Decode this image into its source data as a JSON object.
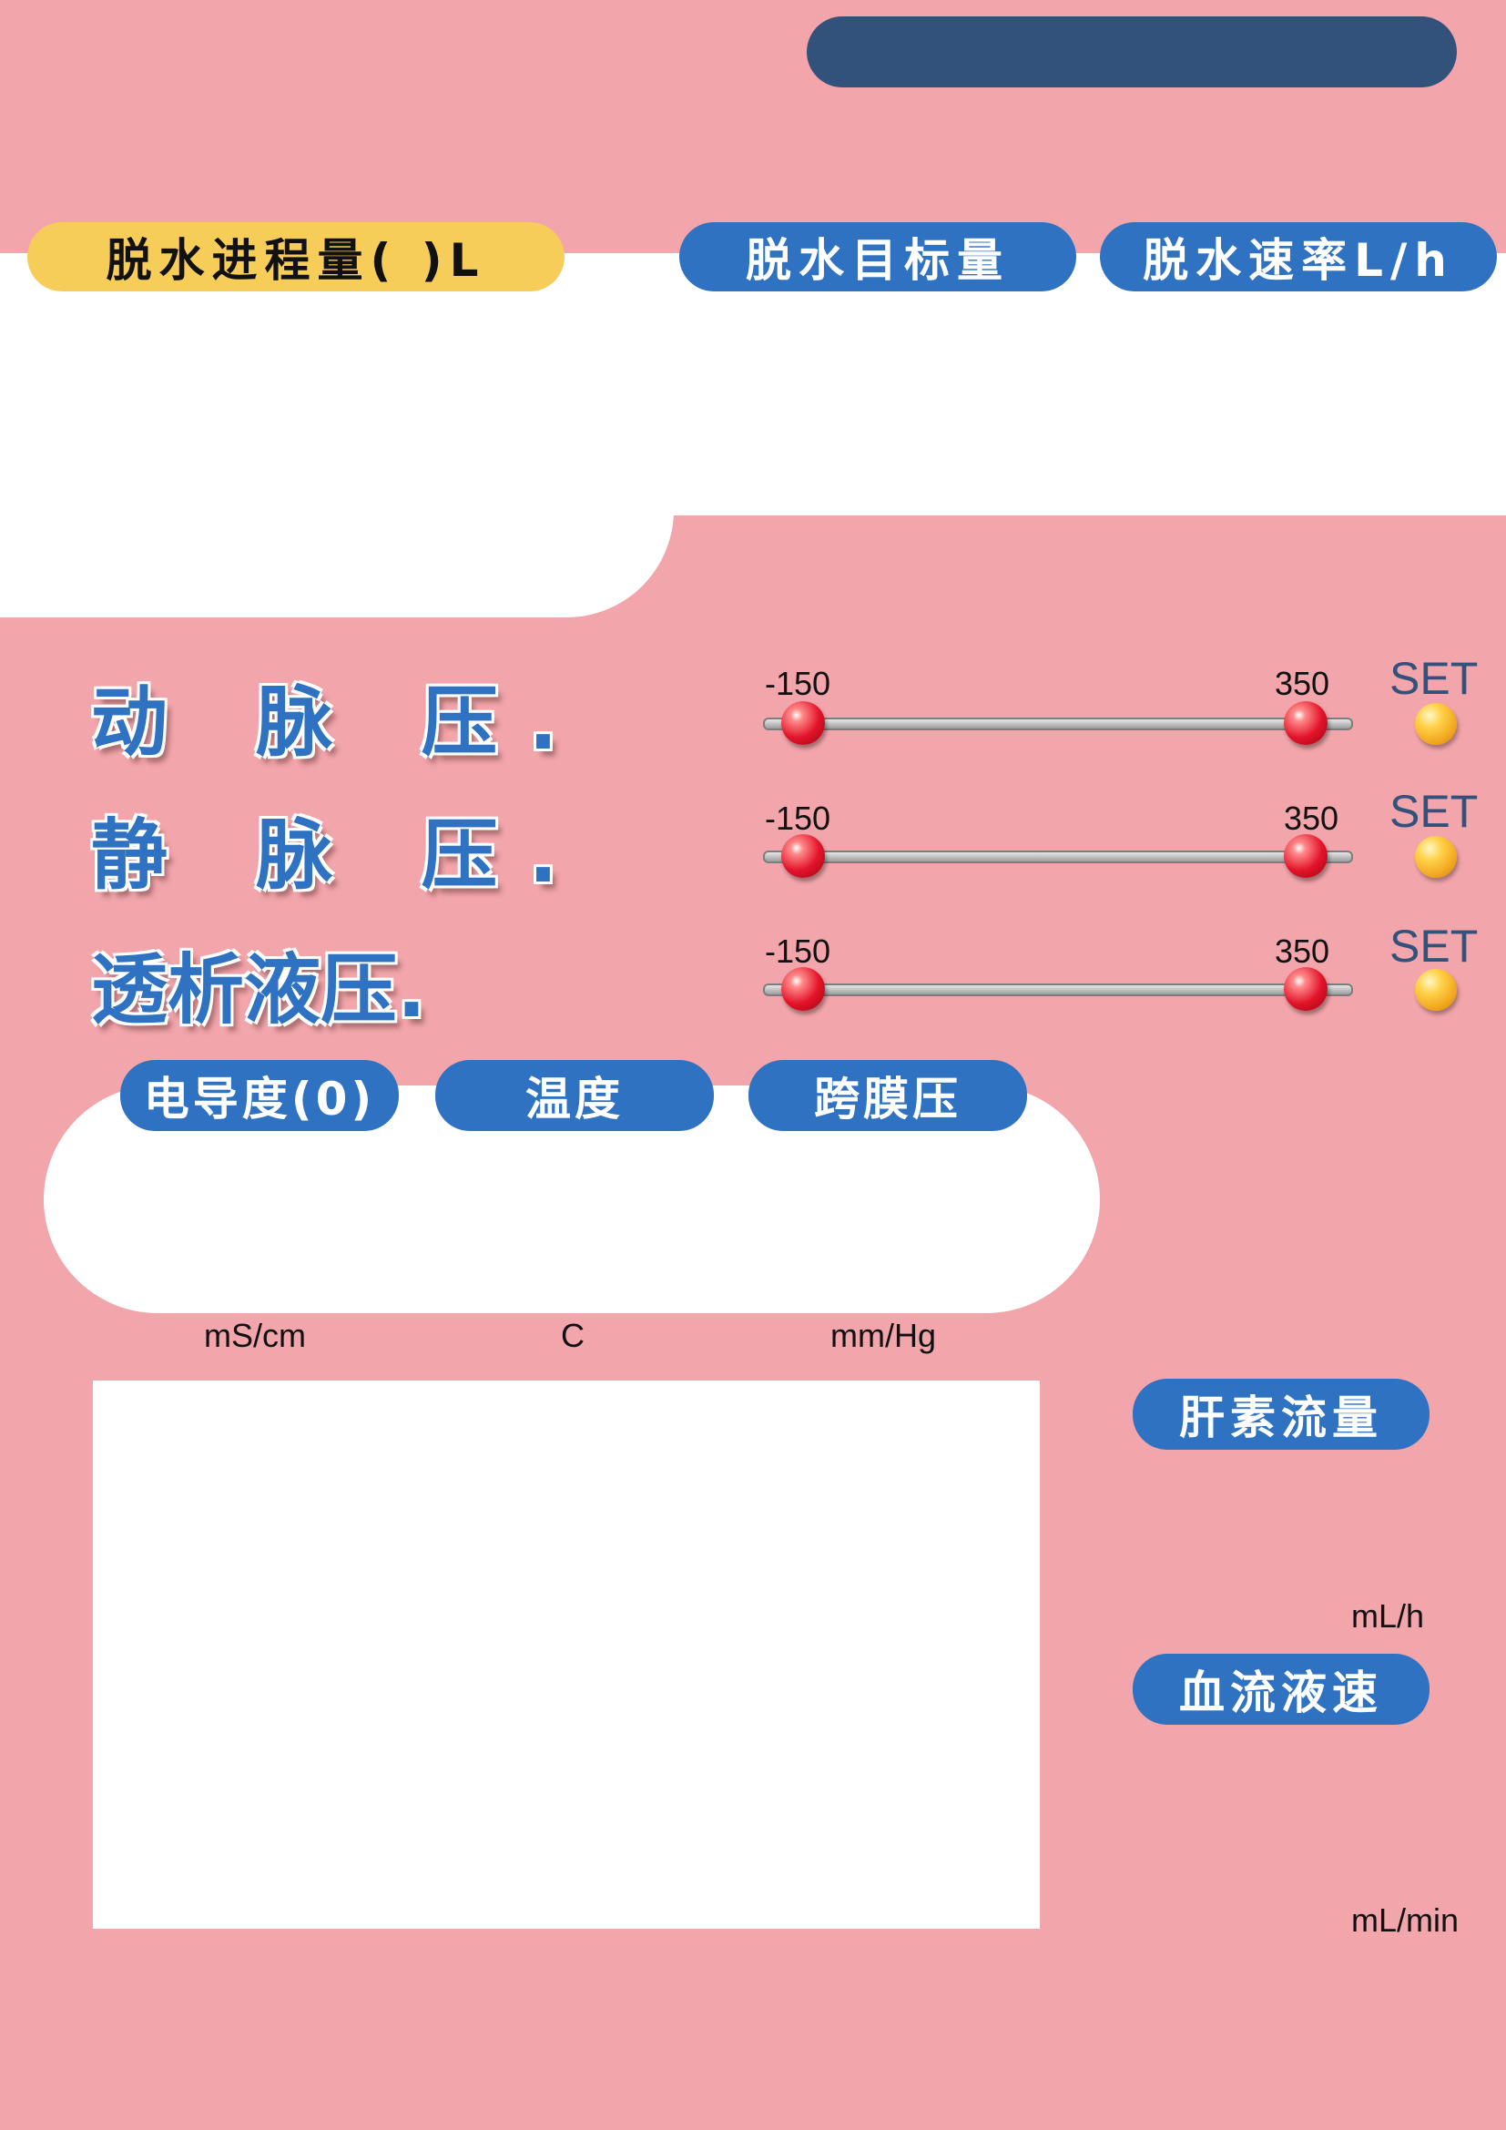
{
  "top": {
    "progress_label": "脱水进程量( )L",
    "target_label": "脱水目标量",
    "rate_label": "脱水速率L/h"
  },
  "pressures": [
    {
      "label": "动 脉 压.",
      "min": "-150",
      "max": "350",
      "set_label": "SET",
      "low_value": -150,
      "high_value": 350
    },
    {
      "label": "静 脉 压.",
      "min": "-150",
      "max": "350",
      "set_label": "SET",
      "low_value": -150,
      "high_value": 350
    },
    {
      "label": "透析液压.",
      "min": "-150",
      "max": "350",
      "set_label": "SET",
      "low_value": -150,
      "high_value": 350
    }
  ],
  "measures": {
    "conductivity_label": "电导度(0)",
    "temperature_label": "温度",
    "tmp_label": "跨膜压",
    "conductivity_unit": "mS/cm",
    "temperature_unit": "C",
    "tmp_unit": "mm/Hg"
  },
  "side": {
    "heparin_label": "肝素流量",
    "heparin_unit": "mL/h",
    "blood_label": "血流液速",
    "blood_unit": "mL/min"
  },
  "colors": {
    "background": "#f2a5aa",
    "accent_blue": "#2f72c1",
    "header_navy": "#33527b",
    "highlight_yellow": "#f7cd59"
  }
}
